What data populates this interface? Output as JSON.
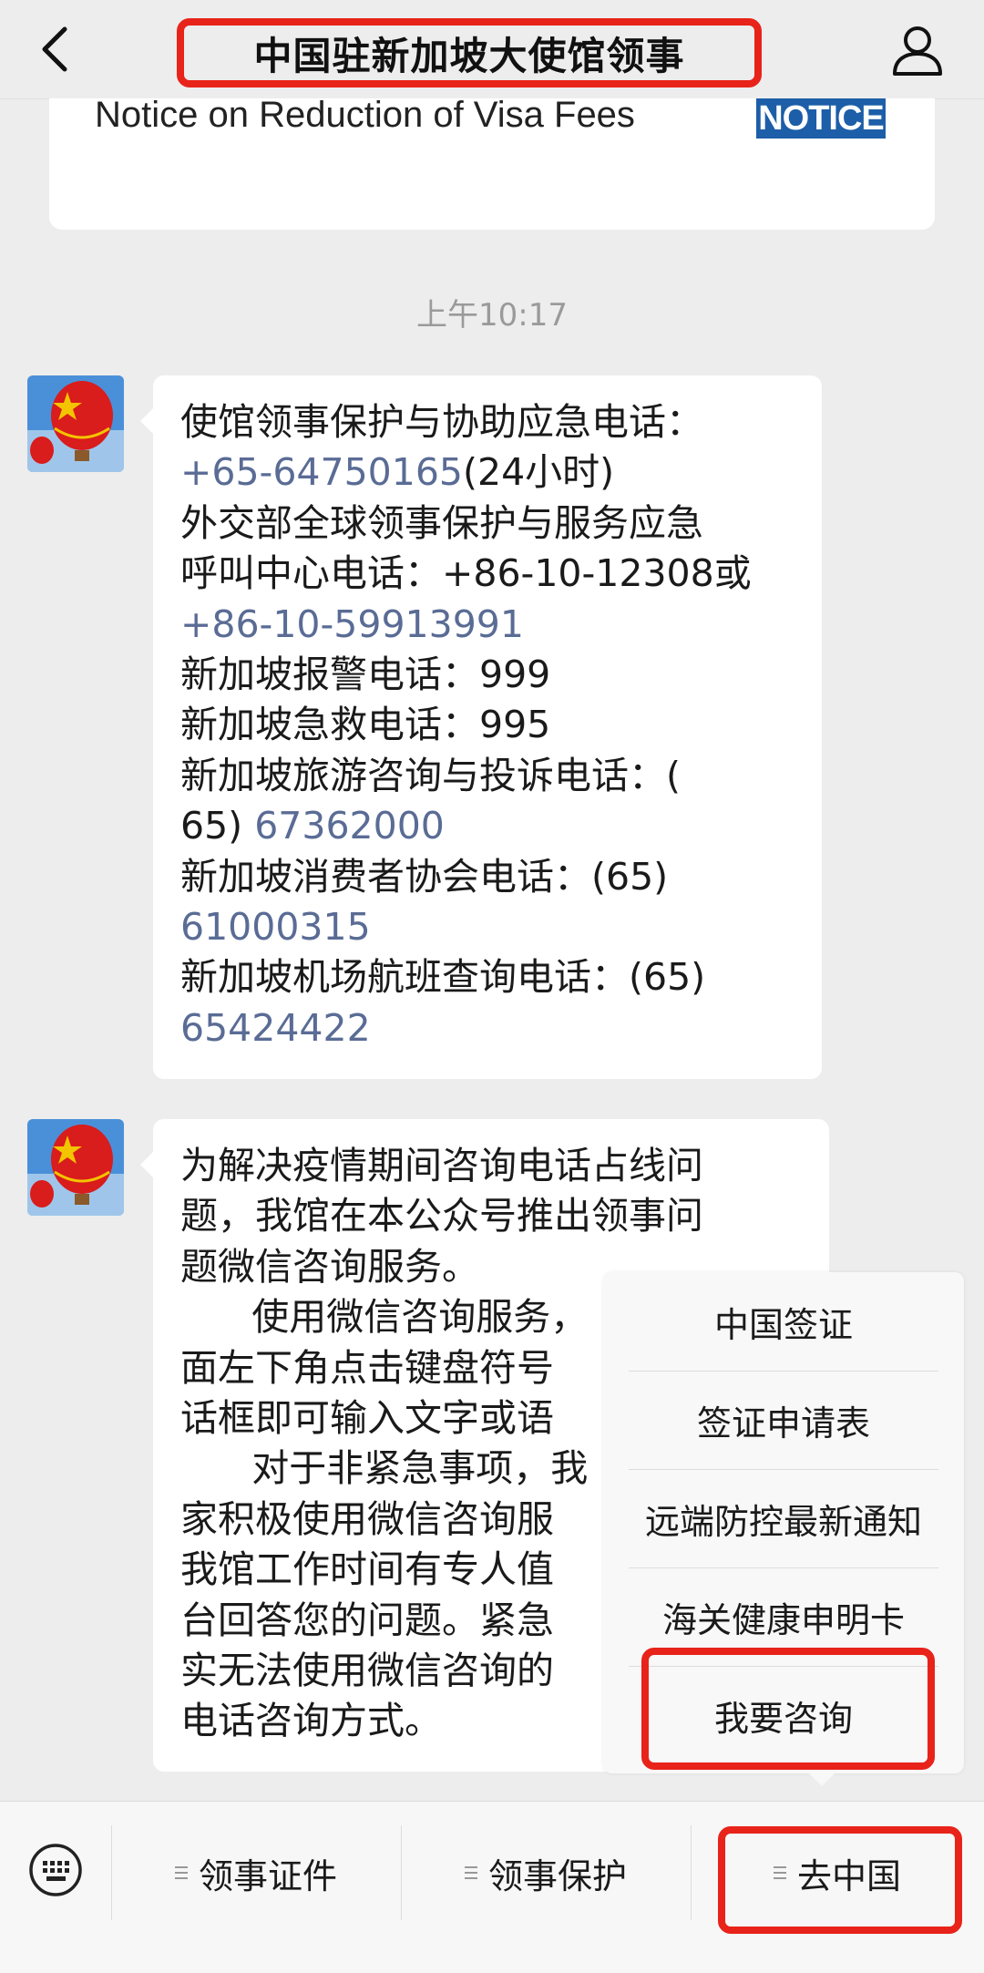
{
  "header": {
    "title": "中国驻新加坡大使馆领事",
    "back_icon": "chevron-left-icon",
    "profile_icon": "person-icon"
  },
  "article": {
    "title": "Notice on Reduction of Visa Fees",
    "badge": "NOTICE"
  },
  "timestamp": "上午10:17",
  "messages": [
    {
      "lines": [
        {
          "text": "使馆领事保护与协助应急电话：",
          "link": ""
        },
        {
          "text": "",
          "link": "+65-64750165",
          "suffix": "(24小时)"
        },
        {
          "text": "外交部全球领事保护与服务应急",
          "link": ""
        },
        {
          "text": "呼叫中心电话：+86-10-12308或",
          "link": ""
        },
        {
          "text": "",
          "link": "+86-10-59913991"
        },
        {
          "text": "新加坡报警电话：999",
          "link": ""
        },
        {
          "text": "新加坡急救电话：995",
          "link": ""
        },
        {
          "text": "新加坡旅游咨询与投诉电话：(",
          "link": ""
        },
        {
          "text": "65) ",
          "link": "67362000"
        },
        {
          "text": "新加坡消费者协会电话：(65)",
          "link": ""
        },
        {
          "text": "",
          "link": "61000315"
        },
        {
          "text": "新加坡机场航班查询电话：(65)",
          "link": ""
        },
        {
          "text": "",
          "link": "65424422"
        }
      ]
    },
    {
      "lines": [
        {
          "text": "为解决疫情期间咨询电话占线问"
        },
        {
          "text": "题，我馆在本公众号推出领事问"
        },
        {
          "text": "题微信咨询服务。"
        },
        {
          "text": "      使用微信咨询服务，"
        },
        {
          "text": "面左下角点击键盘符号"
        },
        {
          "text": "话框即可输入文字或语"
        },
        {
          "text": "      对于非紧急事项，我"
        },
        {
          "text": "家积极使用微信咨询服"
        },
        {
          "text": "我馆工作时间有专人值"
        },
        {
          "text": "台回答您的问题。紧急"
        },
        {
          "text": "实无法使用微信咨询的"
        },
        {
          "text": "电话咨询方式。"
        }
      ]
    }
  ],
  "popup_menu": {
    "items": [
      "中国签证",
      "签证申请表",
      "远端防控最新通知",
      "海关健康申明卡",
      "我要咨询"
    ]
  },
  "bottom_menu": {
    "keyboard_icon": "keyboard-icon",
    "tabs": [
      "领事证件",
      "领事保护",
      "去中国"
    ]
  },
  "colors": {
    "highlight": "#e8231a",
    "link": "#5a6c95",
    "notice_badge": "#1d5ea8"
  }
}
